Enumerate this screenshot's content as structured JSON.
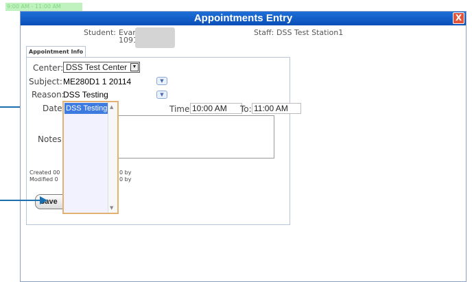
{
  "background": {
    "hint_text": "9:00 AM - 11:00 AM"
  },
  "window": {
    "title": "Appointments Entry",
    "close_label": "X"
  },
  "header": {
    "student_label": "Student:",
    "student_name": "Evan",
    "student_id": "1091",
    "staff_label": "Staff:",
    "staff_name": "DSS Test Station1"
  },
  "tab": {
    "label": "Appointment Info"
  },
  "form": {
    "center_label": "Center:",
    "center_value": "DSS Test Center",
    "subject_label": "Subject:",
    "subject_value": "ME280D1 1 20114",
    "reason_label": "Reason:",
    "reason_value": "DSS Testing",
    "date_label": "Date:",
    "time_label": "Time:",
    "time_value": "10:00 AM",
    "to_label": "To:",
    "to_value": "11:00 AM",
    "notes_label": "Notes:",
    "created_text": "Created 00",
    "created_by": "0 by",
    "modified_text": "Modified 0",
    "modified_by": "0 by",
    "save_label": "Save"
  },
  "dropdown": {
    "selected_item": "DSS Testing"
  },
  "colors": {
    "title_bar": "#0b4fb8",
    "selected_item": "#3d7be0",
    "arrow": "#1a6fb0",
    "dropdown_border": "#e2b070"
  }
}
